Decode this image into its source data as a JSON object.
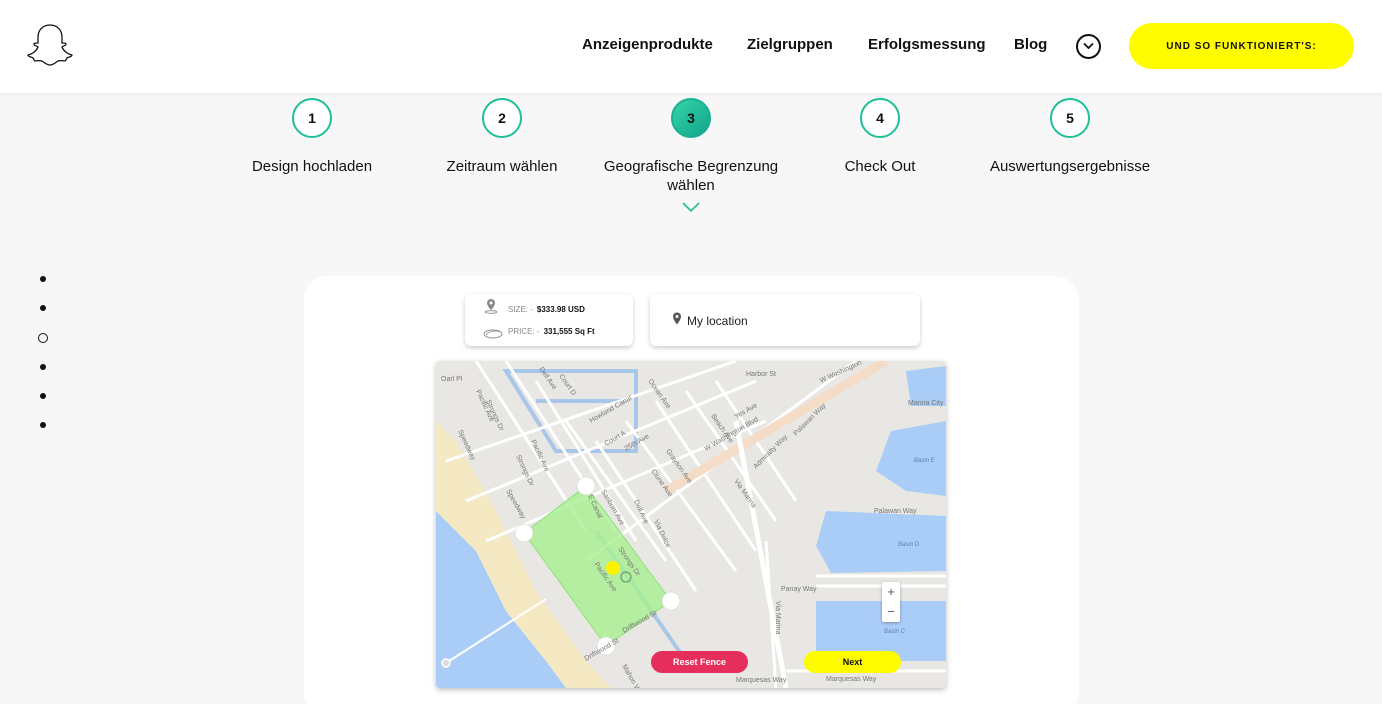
{
  "header": {
    "logo": "snapchat-ghost-icon",
    "nav": [
      "Anzeigenprodukte",
      "Zielgruppen",
      "Erfolgsmessung",
      "Blog"
    ],
    "cta": "UND SO FUNKTIONIERT'S:"
  },
  "steps": [
    {
      "num": "1",
      "label": "Design hochladen"
    },
    {
      "num": "2",
      "label": "Zeitraum wählen"
    },
    {
      "num": "3",
      "label": "Geografische Begrenzung wählen"
    },
    {
      "num": "4",
      "label": "Check Out"
    },
    {
      "num": "5",
      "label": "Auswertungsergebnisse"
    }
  ],
  "active_step": 3,
  "info": {
    "size_label": "SIZE: -",
    "size_value": "$333.98 USD",
    "price_label": "PRICE: -",
    "price_value": "331,555 Sq Ft"
  },
  "location": {
    "placeholder": "My location"
  },
  "map": {
    "streets": [
      "Harbor St",
      "W Washington",
      "Ocean Ave",
      "Court D",
      "Dell Ave",
      "Howland Canal",
      "Court A",
      "25th Ave",
      "Grayson Ave",
      "Clune Ave",
      "Beach Ave",
      "Yes Ave",
      "W Washington Blvd",
      "Palawan Way",
      "Admiralty Way",
      "Via Marina",
      "Marina City",
      "Basin E",
      "Palawan Way",
      "Basin D",
      "Panay Way",
      "Via Marina",
      "Basin C",
      "Marquesas Way",
      "Marquesas Way",
      "Strongs Dr",
      "Pacific Ave",
      "Speedway",
      "Sanborn Ave",
      "Driftwood St",
      "Via Dolce",
      "Dell Ave",
      "Strongs Dr",
      "Pacific Ave",
      "E Canal",
      "Speedway",
      "Oarl Pl",
      "Pacific Ave",
      "Strongs Dr",
      "Driftwood St",
      "Mahon Way"
    ],
    "zoom_in": "+",
    "zoom_out": "−",
    "reset_label": "Reset Fence",
    "next_label": "Next"
  },
  "colors": {
    "accent": "#1fbf9a",
    "cta": "#fffc00",
    "reset": "#e62e5c",
    "fence": "#a8f090"
  }
}
